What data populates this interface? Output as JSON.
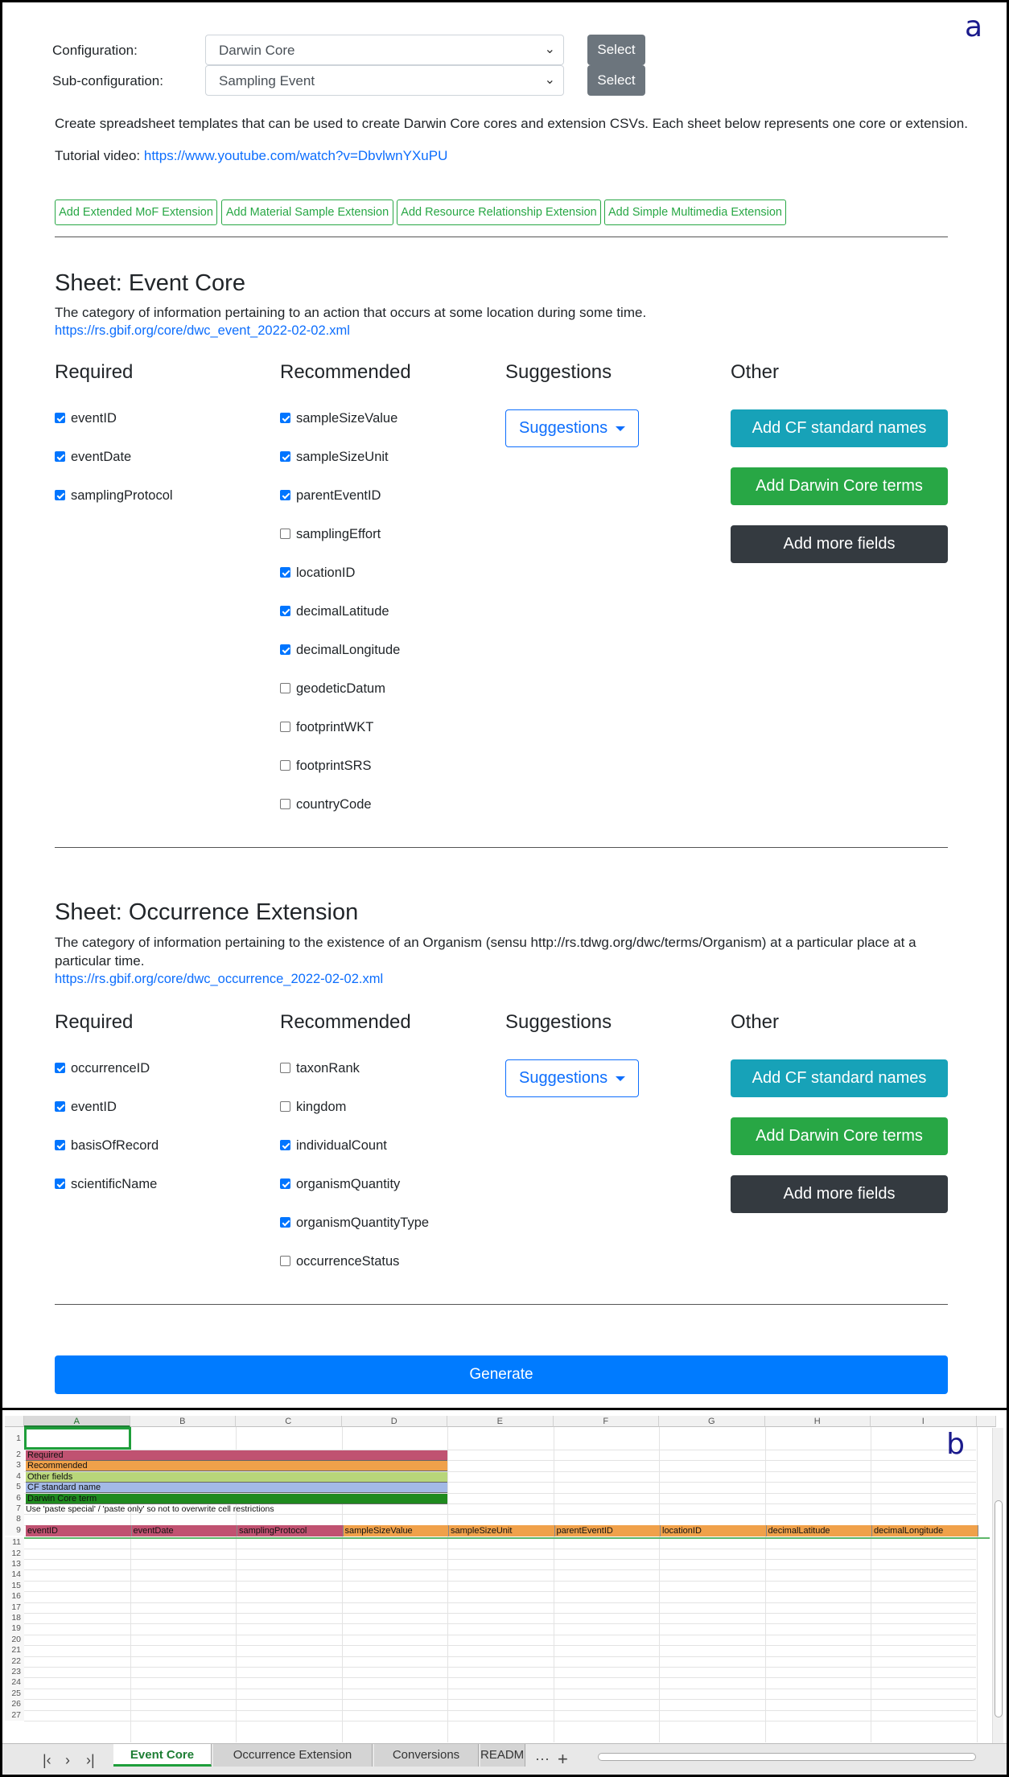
{
  "panel_labels": {
    "a": "a",
    "b": "b"
  },
  "config": {
    "configuration_label": "Configuration:",
    "configuration_value": "Darwin Core",
    "subconfiguration_label": "Sub-configuration:",
    "subconfiguration_value": "Sampling Event",
    "select_label": "Select"
  },
  "intro": {
    "description": "Create spreadsheet templates that can be used to create Darwin Core cores and extension CSVs. Each sheet below represents one core or extension.",
    "tutorial_prefix": "Tutorial video: ",
    "tutorial_link": "https://www.youtube.com/watch?v=DbvlwnYXuPU"
  },
  "extension_buttons": [
    "Add Extended MoF Extension",
    "Add Material Sample Extension",
    "Add Resource Relationship Extension",
    "Add Simple Multimedia Extension"
  ],
  "column_headings": {
    "required": "Required",
    "recommended": "Recommended",
    "suggestions": "Suggestions",
    "other": "Other"
  },
  "buttons": {
    "suggestions": "Suggestions",
    "add_cf": "Add CF standard names",
    "add_dwc": "Add Darwin Core terms",
    "add_more": "Add more fields",
    "generate": "Generate"
  },
  "sheets": [
    {
      "title": "Sheet: Event Core",
      "description": "The category of information pertaining to an action that occurs at some location during some time.",
      "link": "https://rs.gbif.org/core/dwc_event_2022-02-02.xml",
      "required": [
        {
          "name": "eventID",
          "checked": true
        },
        {
          "name": "eventDate",
          "checked": true
        },
        {
          "name": "samplingProtocol",
          "checked": true
        }
      ],
      "recommended": [
        {
          "name": "sampleSizeValue",
          "checked": true
        },
        {
          "name": "sampleSizeUnit",
          "checked": true
        },
        {
          "name": "parentEventID",
          "checked": true
        },
        {
          "name": "samplingEffort",
          "checked": false
        },
        {
          "name": "locationID",
          "checked": true
        },
        {
          "name": "decimalLatitude",
          "checked": true
        },
        {
          "name": "decimalLongitude",
          "checked": true
        },
        {
          "name": "geodeticDatum",
          "checked": false
        },
        {
          "name": "footprintWKT",
          "checked": false
        },
        {
          "name": "footprintSRS",
          "checked": false
        },
        {
          "name": "countryCode",
          "checked": false
        }
      ]
    },
    {
      "title": "Sheet: Occurrence Extension",
      "description": "The category of information pertaining to the existence of an Organism (sensu http://rs.tdwg.org/dwc/terms/Organism) at a particular place at a particular time.",
      "link": "https://rs.gbif.org/core/dwc_occurrence_2022-02-02.xml",
      "required": [
        {
          "name": "occurrenceID",
          "checked": true
        },
        {
          "name": "eventID",
          "checked": true
        },
        {
          "name": "basisOfRecord",
          "checked": true
        },
        {
          "name": "scientificName",
          "checked": true
        }
      ],
      "recommended": [
        {
          "name": "taxonRank",
          "checked": false
        },
        {
          "name": "kingdom",
          "checked": false
        },
        {
          "name": "individualCount",
          "checked": true
        },
        {
          "name": "organismQuantity",
          "checked": true
        },
        {
          "name": "organismQuantityType",
          "checked": true
        },
        {
          "name": "occurrenceStatus",
          "checked": false
        }
      ]
    }
  ],
  "spreadsheet": {
    "columns": [
      "A",
      "B",
      "C",
      "D",
      "E",
      "F",
      "G",
      "H",
      "I"
    ],
    "rows": [
      "1",
      "2",
      "3",
      "4",
      "5",
      "6",
      "7",
      "8",
      "9",
      "11",
      "12",
      "13",
      "14",
      "15",
      "16",
      "17",
      "18",
      "19",
      "20",
      "21",
      "22",
      "23",
      "24",
      "25",
      "26",
      "27"
    ],
    "legend": [
      {
        "label": "Required",
        "color": "#c05271"
      },
      {
        "label": "Recommended",
        "color": "#f0a14a"
      },
      {
        "label": "Other fields",
        "color": "#b8d67a"
      },
      {
        "label": "CF standard name",
        "color": "#a3b9e6"
      },
      {
        "label": "Darwin Core term",
        "color": "#1f8a1f"
      }
    ],
    "note": "Use 'paste special' / 'paste only' so not to overwrite cell restrictions",
    "header_row": [
      {
        "label": "eventID",
        "type": "required"
      },
      {
        "label": "eventDate",
        "type": "required"
      },
      {
        "label": "samplingProtocol",
        "type": "required"
      },
      {
        "label": "sampleSizeValue",
        "type": "recommended"
      },
      {
        "label": "sampleSizeUnit",
        "type": "recommended"
      },
      {
        "label": "parentEventID",
        "type": "recommended"
      },
      {
        "label": "locationID",
        "type": "recommended"
      },
      {
        "label": "decimalLatitude",
        "type": "recommended"
      },
      {
        "label": "decimalLongitude",
        "type": "recommended"
      }
    ],
    "tabs": [
      "Event Core",
      "Occurrence Extension",
      "Conversions",
      "README"
    ],
    "active_tab": "Event Core"
  }
}
